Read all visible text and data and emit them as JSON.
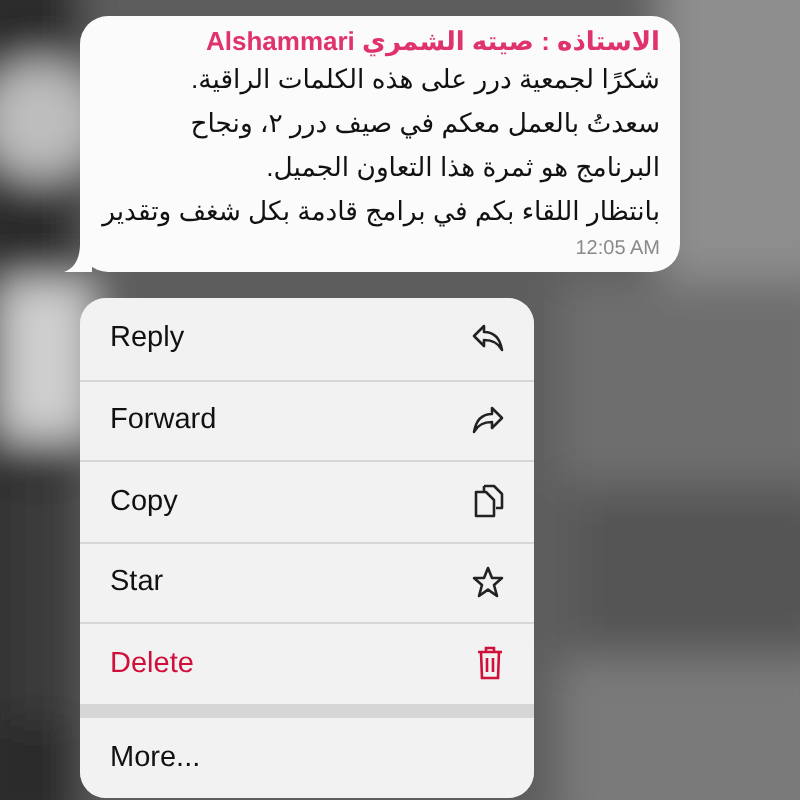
{
  "message": {
    "sender": "الاستاذه : صيته الشمري Alshammari",
    "lines": [
      "شكرًا لجمعية درر على هذه الكلمات الراقية.",
      "سعدتُ بالعمل معكم في صيف درر ٢، ونجاح",
      "البرنامج هو ثمرة هذا التعاون الجميل.",
      "بانتظار اللقاء بكم في برامج قادمة بكل شغف وتقدير"
    ],
    "time": "12:05 AM"
  },
  "menu": [
    {
      "label": "Reply",
      "kind": "reply"
    },
    {
      "label": "Forward",
      "kind": "forward"
    },
    {
      "label": "Copy",
      "kind": "copy"
    },
    {
      "label": "Star",
      "kind": "star"
    },
    {
      "label": "Delete",
      "kind": "delete"
    },
    {
      "label": "More...",
      "kind": "more"
    }
  ]
}
